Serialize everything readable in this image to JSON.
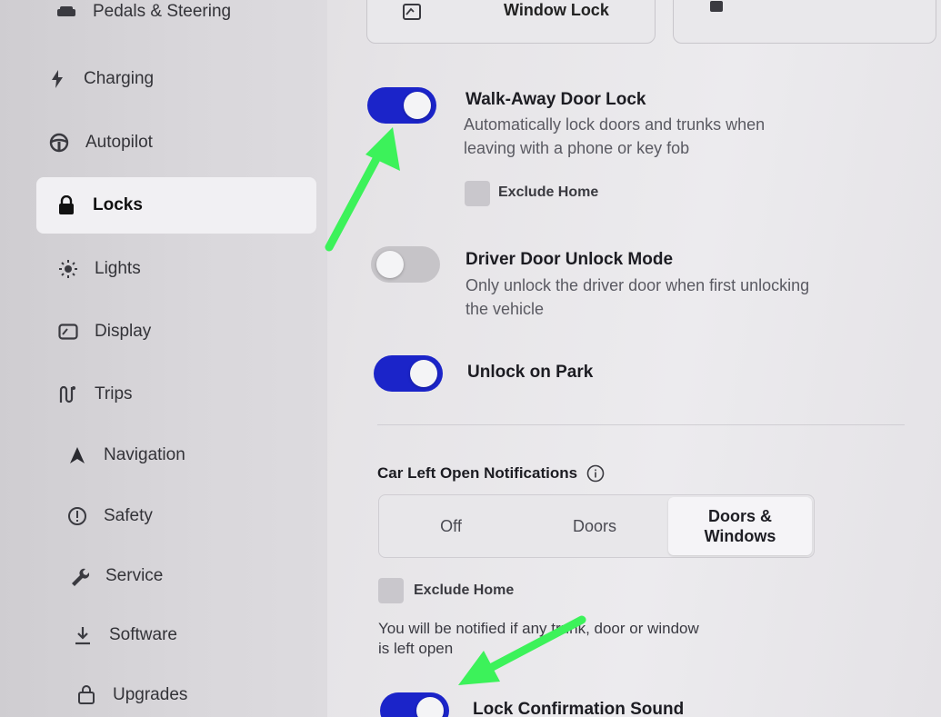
{
  "sidebar": {
    "items": [
      {
        "label": "Pedals & Steering",
        "icon": "car-icon"
      },
      {
        "label": "Charging",
        "icon": "bolt-icon"
      },
      {
        "label": "Autopilot",
        "icon": "steering-wheel-icon"
      },
      {
        "label": "Locks",
        "icon": "lock-icon",
        "active": true
      },
      {
        "label": "Lights",
        "icon": "sun-icon"
      },
      {
        "label": "Display",
        "icon": "display-icon"
      },
      {
        "label": "Trips",
        "icon": "trips-icon"
      },
      {
        "label": "Navigation",
        "icon": "navigation-icon"
      },
      {
        "label": "Safety",
        "icon": "alert-circle-icon"
      },
      {
        "label": "Service",
        "icon": "wrench-icon"
      },
      {
        "label": "Software",
        "icon": "download-icon"
      },
      {
        "label": "Upgrades",
        "icon": "bag-icon"
      }
    ]
  },
  "top_cards": {
    "window_lock_label": "Window Lock"
  },
  "settings": {
    "walk_away": {
      "title": "Walk-Away Door Lock",
      "desc_line1": "Automatically lock doors and trunks when",
      "desc_line2": "leaving with a phone or key fob",
      "enabled": true,
      "exclude_home_label": "Exclude Home"
    },
    "driver_door": {
      "title": "Driver Door Unlock Mode",
      "desc_line1": "Only unlock the driver door when first unlocking",
      "desc_line2": "the vehicle",
      "enabled": false
    },
    "unlock_on_park": {
      "title": "Unlock on Park",
      "enabled": true
    },
    "car_left_open": {
      "title": "Car Left Open Notifications",
      "options": [
        "Off",
        "Doors",
        "Doors &",
        "Windows"
      ],
      "selected": "Doors & Windows",
      "exclude_home_label": "Exclude Home",
      "note_line1": "You will be notified if any trunk, door or window",
      "note_line2": "is left open"
    },
    "lock_confirmation": {
      "title": "Lock Confirmation Sound",
      "enabled": true
    }
  },
  "colors": {
    "toggle_on": "#1b24c9",
    "arrow": "#3cf25a"
  }
}
